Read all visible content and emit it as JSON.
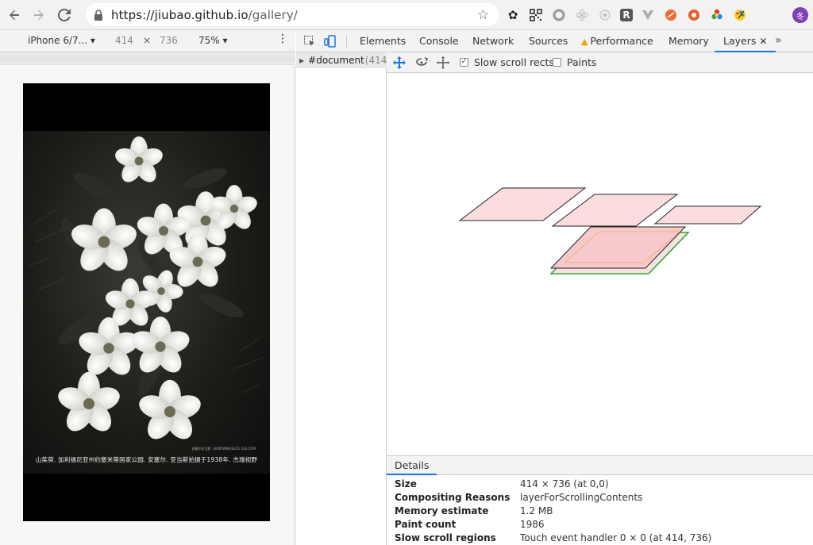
{
  "browser": {
    "url_host": "https://jiubao.github.io",
    "url_path": "/gallery/",
    "avatar_label": "冬"
  },
  "device_toolbar": {
    "device": "iPhone 6/7...",
    "width": "414",
    "times": "×",
    "height": "736",
    "zoom": "75%"
  },
  "page": {
    "caption": "山茱萸. 加利福尼亚州约塞米蒂国家公园. 安塞尔. 亚当斯拍摄于1938年. 杰瑞视野",
    "caption_small": "安塞尔亚当斯 · JERRYWAN.BLOG.163.COM"
  },
  "devtools": {
    "tabs": [
      {
        "label": "Elements"
      },
      {
        "label": "Console"
      },
      {
        "label": "Network"
      },
      {
        "label": "Sources"
      },
      {
        "label": "Performance"
      },
      {
        "label": "Memory"
      },
      {
        "label": "Layers"
      }
    ],
    "more": "»",
    "tree_node": {
      "tag": "#document",
      "dim": "(414",
      "close": "×"
    },
    "toolbar": {
      "slow_scroll_label": "Slow scroll rects",
      "paints_label": "Paints"
    },
    "details": {
      "tab": "Details",
      "rows": [
        {
          "key": "Size",
          "value": "414 × 736 (at 0,0)"
        },
        {
          "key": "Compositing Reasons",
          "value": "layerForScrollingContents"
        },
        {
          "key": "Memory estimate",
          "value": "1.2 MB"
        },
        {
          "key": "Paint count",
          "value": "1986"
        },
        {
          "key": "Slow scroll regions",
          "value": "Touch event handler 0 × 0 (at 414, 736)"
        }
      ]
    }
  },
  "colors": {
    "accent": "#1a73e8",
    "layer_fill": "#fbdde0",
    "layer_selected": "#f8c9cc",
    "green_edge": "#2fa82f",
    "warn": "#e8a500"
  }
}
